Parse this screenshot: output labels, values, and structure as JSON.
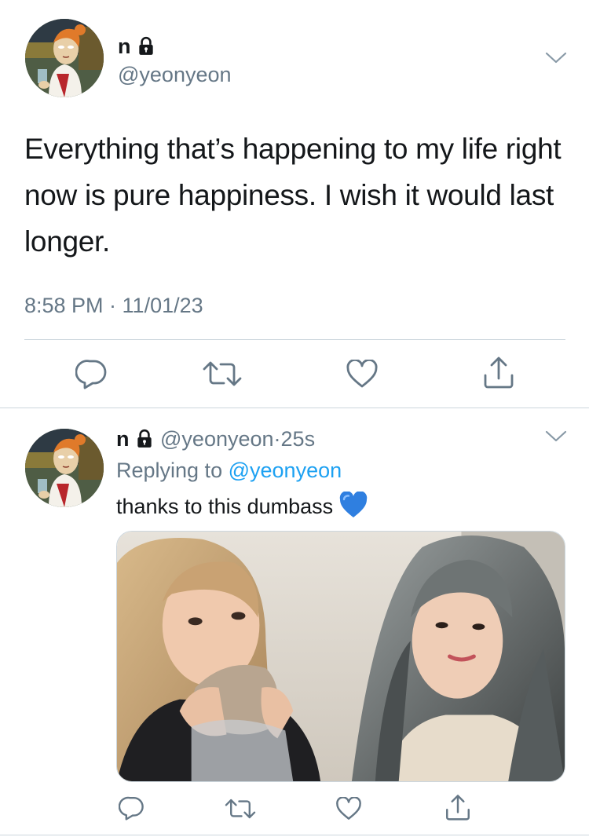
{
  "main_tweet": {
    "display_name": "n",
    "handle": "@yeonyeon",
    "text": "Everything that’s happening to my life right now is pure happiness. I wish it would last longer.",
    "timestamp": "8:58 PM · 11/01/23",
    "actions": [
      "reply-icon",
      "retweet-icon",
      "like-icon",
      "share-icon"
    ]
  },
  "reply_tweet": {
    "display_name": "n",
    "handle": "@yeonyeon",
    "separator": "·",
    "age": "25s",
    "replying_prefix": "Replying to",
    "replying_to": "@yeonyeon",
    "text": "thanks to this dumbass",
    "emoji": "blue-heart-emoji",
    "actions": [
      "reply-icon",
      "retweet-icon",
      "like-icon",
      "share-icon"
    ]
  },
  "colors": {
    "text": "#14171a",
    "secondary": "#657786",
    "link": "#1da1f2",
    "divider": "#ccd6dd"
  }
}
